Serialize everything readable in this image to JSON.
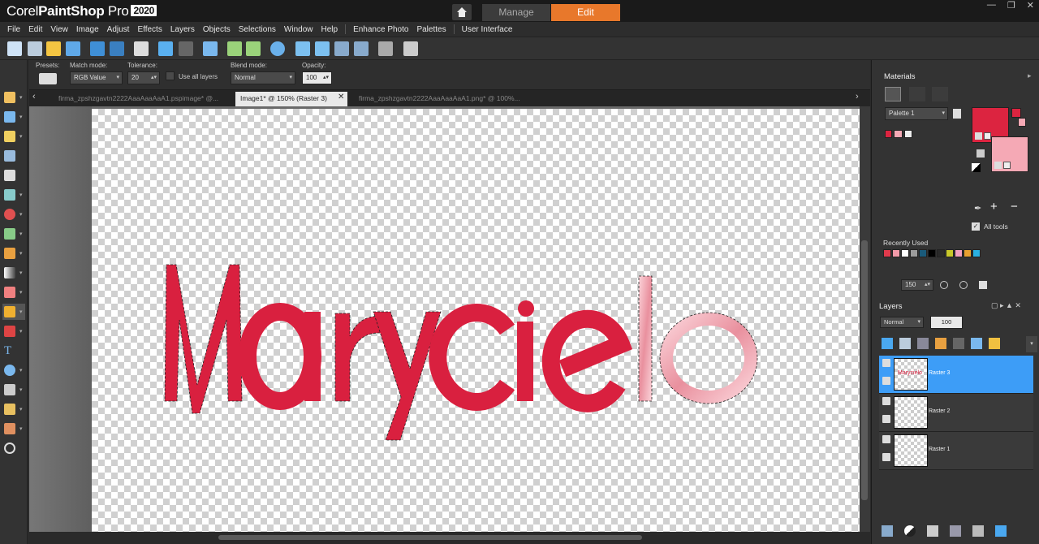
{
  "app": {
    "brand_corel": "Corel",
    "brand_product": "PaintShop",
    "brand_pro": "Pro",
    "brand_year": "2020",
    "workspace_tabs": [
      "Manage",
      "Edit"
    ],
    "active_workspace": "Edit"
  },
  "menu": [
    "File",
    "Edit",
    "View",
    "Image",
    "Adjust",
    "Effects",
    "Layers",
    "Objects",
    "Selections",
    "Window",
    "Help",
    "Enhance Photo",
    "Palettes",
    "User Interface"
  ],
  "options": {
    "presets_label": "Presets:",
    "match_mode_label": "Match mode:",
    "match_mode_value": "RGB Value",
    "tolerance_label": "Tolerance:",
    "tolerance_value": "20",
    "use_all_layers_label": "Use all layers",
    "blend_mode_label": "Blend mode:",
    "blend_mode_value": "Normal",
    "opacity_label": "Opacity:",
    "opacity_value": "100"
  },
  "documents": [
    {
      "title": "firma_zpshzgavtn2222AaaAaaAaA1.pspimage* @...",
      "active": false
    },
    {
      "title": "Image1* @ 150% (Raster 3)",
      "active": true
    },
    {
      "title": "firma_zpshzgavtn2222AaaAaaAaA1.png* @  100%...",
      "active": false
    }
  ],
  "canvas": {
    "artwork_text": "Marycielo",
    "color_main": "#d9203f",
    "color_light": "#f2a8b3"
  },
  "materials": {
    "title": "Materials",
    "palette_value": "Palette 1",
    "foreground_color": "#dc2440",
    "background_color": "#f5a9b5",
    "all_tools_label": "All tools",
    "recently_used_label": "Recently Used",
    "recent_colors": [
      "#e03a4c",
      "#f49aa9",
      "#ffffff",
      "#9c9c9c",
      "#1a5a7a",
      "#000000",
      "#2a2a2a",
      "#c8c82a",
      "#f2a0c0",
      "#e8a030",
      "#2ab0e0"
    ],
    "zoom_value": "150"
  },
  "layers": {
    "title": "Layers",
    "blend_mode": "Normal",
    "opacity": "100",
    "items": [
      {
        "name": "Raster 3",
        "selected": true
      },
      {
        "name": "Raster 2",
        "selected": false
      },
      {
        "name": "Raster 1",
        "selected": false
      }
    ]
  }
}
